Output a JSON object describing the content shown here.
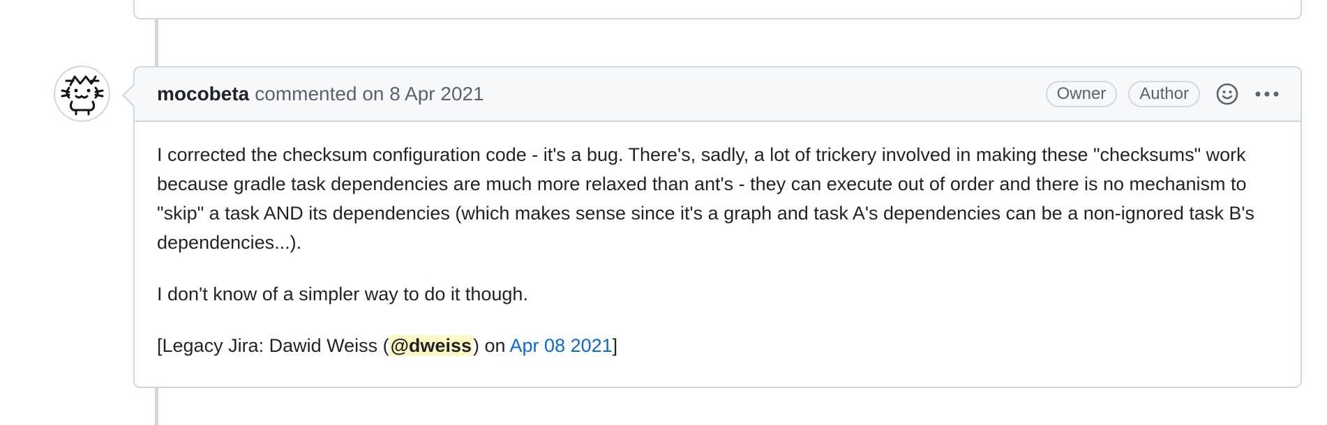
{
  "comment": {
    "author": "mocobeta",
    "action_text": "commented on",
    "date": "8 Apr 2021",
    "badges": [
      "Owner",
      "Author"
    ],
    "icons": {
      "reaction": "smiley-icon",
      "more": "kebab-horizontal-icon"
    },
    "body": {
      "paragraph1": "I corrected the checksum configuration code - it's a bug. There's, sadly, a lot of trickery involved in making these \"checksums\" work because gradle task dependencies are much more relaxed than ant's - they can execute out of order and there is no mechanism to \"skip\" a task AND its dependencies (which makes sense since it's a graph and task A's dependencies can be a non-ignored task B's dependencies...).",
      "paragraph2": "I don't know of a simpler way to do it though.",
      "legacy": {
        "prefix": "[Legacy Jira: Dawid Weiss (",
        "mention": "@dweiss",
        "middle": ") on ",
        "link_text": "Apr 08 2021",
        "suffix": "]"
      }
    }
  },
  "colors": {
    "border": "#d0d7de",
    "header_bg": "#f6f8fa",
    "muted_text": "#59636e",
    "link": "#0969da",
    "mention_bg": "#fff8c5"
  }
}
